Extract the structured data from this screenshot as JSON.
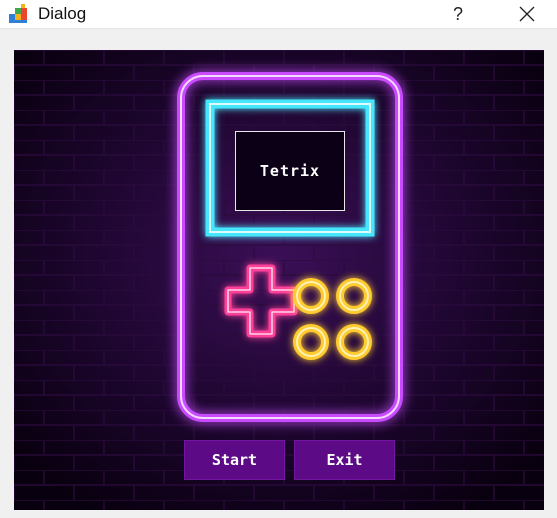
{
  "window": {
    "title": "Dialog",
    "help_label": "?",
    "app_icon": "tetris-blocks-icon",
    "close_icon": "close-icon"
  },
  "screen": {
    "title": "Tetrix"
  },
  "buttons": {
    "start_label": "Start",
    "exit_label": "Exit"
  },
  "colors": {
    "console_neon": "#c94bff",
    "screen_neon": "#46e6ff",
    "dpad_neon": "#ff3f9a",
    "action_buttons_neon": "#ffcb2f",
    "button_bg": "#5c0a86",
    "background": "#12001d"
  }
}
